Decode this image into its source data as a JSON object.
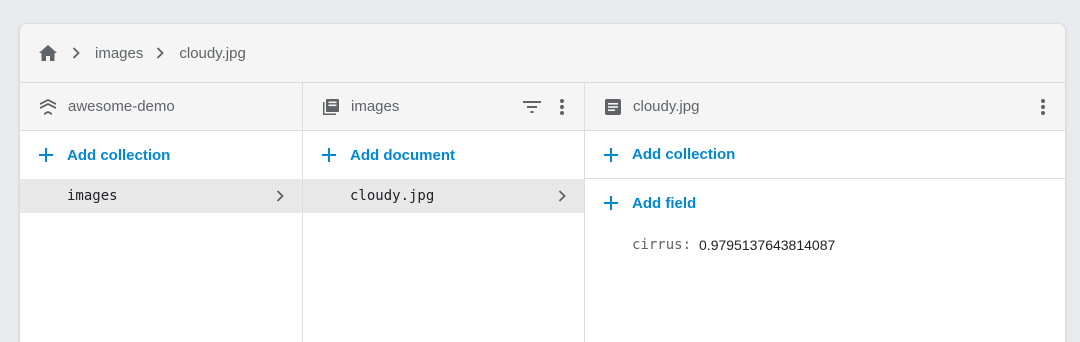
{
  "breadcrumb": {
    "home_icon": "home-icon",
    "items": [
      "images",
      "cloudy.jpg"
    ]
  },
  "columns": {
    "root": {
      "title": "awesome-demo",
      "icon": "database-layers-icon",
      "add_label": "Add collection",
      "items": [
        "images"
      ]
    },
    "collection": {
      "title": "images",
      "icon": "collection-icon",
      "add_label": "Add document",
      "items": [
        "cloudy.jpg"
      ]
    },
    "document": {
      "title": "cloudy.jpg",
      "icon": "document-icon",
      "add_collection_label": "Add collection",
      "add_field_label": "Add field",
      "fields": [
        {
          "key": "cirrus:",
          "value": "0.9795137643814087"
        }
      ]
    }
  },
  "colors": {
    "accent": "#0288d1",
    "header_bg": "#f5f5f5",
    "selected_bg": "#e8e8e8"
  }
}
